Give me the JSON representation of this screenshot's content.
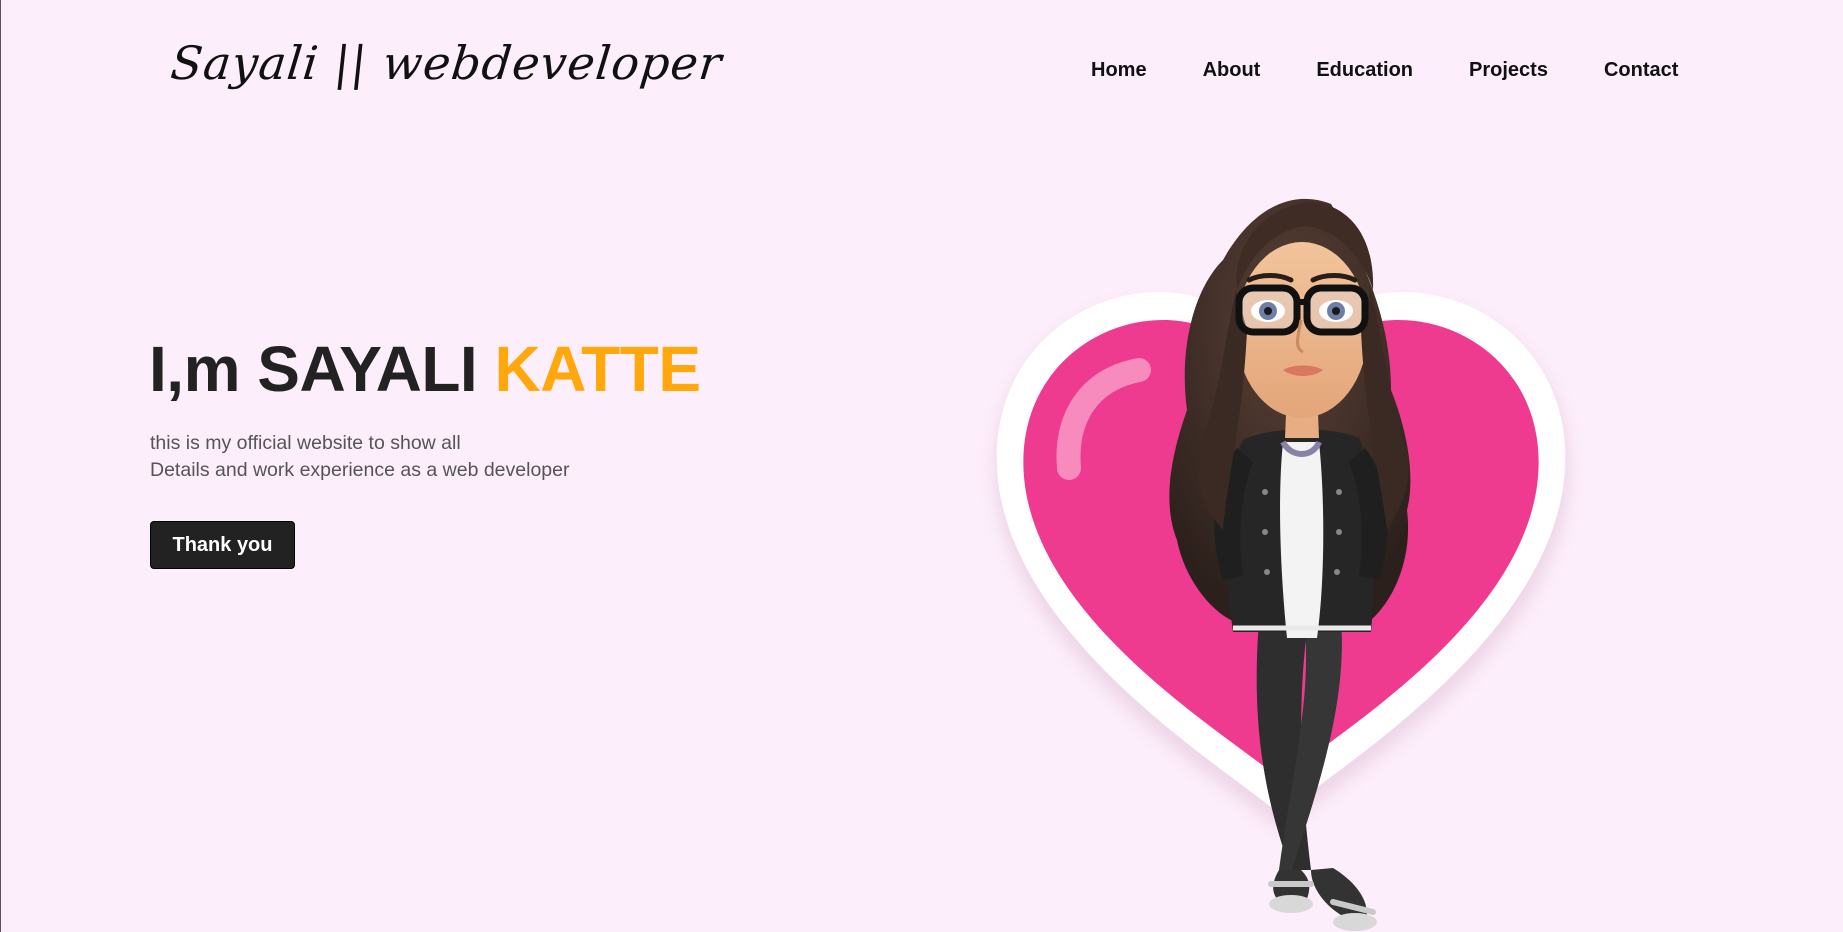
{
  "header": {
    "logo_text": "Sayali || webdeveloper"
  },
  "nav": {
    "items": [
      "Home",
      "About",
      "Education",
      "Projects",
      "Contact"
    ]
  },
  "hero": {
    "title_main": "I,m SAYALI ",
    "title_accent": "KATTE",
    "description_line1": "this is my official website to show all",
    "description_line2": "Details and work experience as a web developer",
    "button_label": "Thank you"
  },
  "colors": {
    "background": "#fdeefb",
    "accent": "#ffa70b",
    "heart": "#ef3b8f",
    "text_dark": "#222222"
  },
  "illustration": {
    "icon": "avatar-with-heart"
  }
}
